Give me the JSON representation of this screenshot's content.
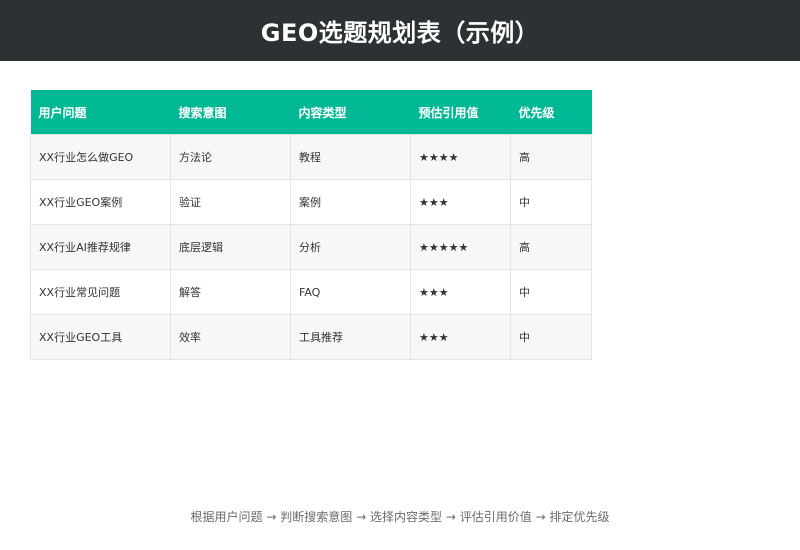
{
  "title": "GEO选题规划表（示例）",
  "table": {
    "headers": [
      "用户问题",
      "搜索意图",
      "内容类型",
      "预估引用值",
      "优先级"
    ],
    "rows": [
      [
        "XX行业怎么做GEO",
        "方法论",
        "教程",
        "★★★★",
        "高"
      ],
      [
        "XX行业GEO案例",
        "验证",
        "案例",
        "★★★",
        "中"
      ],
      [
        "XX行业AI推荐规律",
        "底层逻辑",
        "分析",
        "★★★★★",
        "高"
      ],
      [
        "XX行业常见问题",
        "解答",
        "FAQ",
        "★★★",
        "中"
      ],
      [
        "XX行业GEO工具",
        "效率",
        "工具推荐",
        "★★★",
        "中"
      ]
    ]
  },
  "flow": {
    "steps": [
      "根据用户问题",
      "判断搜索意图",
      "选择内容类型",
      "评估引用价值",
      "排定优先级"
    ],
    "arrow": "→"
  },
  "colors": {
    "title_bar": "#2c3133",
    "header_bg": "#00b894",
    "row_alt_bg": "#f6f7f9",
    "border": "#e2e4e6"
  }
}
